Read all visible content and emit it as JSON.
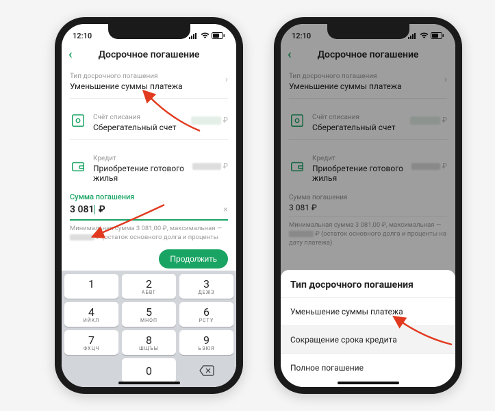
{
  "status": {
    "time": "12:10"
  },
  "nav": {
    "title": "Досрочное погашение"
  },
  "typeRow": {
    "label": "Тип досрочного погашения",
    "value": "Уменьшение суммы платежа"
  },
  "account": {
    "label": "Счёт списания",
    "value": "Сберегательный счет",
    "currency": "₽"
  },
  "credit": {
    "label": "Кредит",
    "value": "Приобретение готового жилья",
    "currency": "₽"
  },
  "amount": {
    "label": "Сумма погашения",
    "value": "3 081",
    "currency": "₽",
    "valueCombined": "3 081 ₽"
  },
  "hintLeft": "Минимальная сумма 3 081,00 ₽, максимальная —",
  "hintLeft2": "₽ (остаток основного долга и проценты",
  "hintRight1": "Минимальная сумма 3 081,00 ₽, максимальная —",
  "hintRight2": "₽ (остаток основного долга и проценты на дату платежа)",
  "continue": "Продолжить",
  "keypad": {
    "k1": "1",
    "k2": "2",
    "k2s": "АБВГ",
    "k3": "3",
    "k3s": "ДЕЖЗ",
    "k4": "4",
    "k4s": "ИЙКЛ",
    "k5": "5",
    "k5s": "МНОП",
    "k6": "6",
    "k6s": "РСТУ",
    "k7": "7",
    "k7s": "ФХЦЧ",
    "k8": "8",
    "k8s": "ШЩЪЫ",
    "k9": "9",
    "k9s": "ЬЭЮЯ",
    "k0": "0"
  },
  "sheet": {
    "title": "Тип досрочного погашения",
    "opt1": "Уменьшение суммы платежа",
    "opt2": "Сокращение срока кредита",
    "opt3": "Полное погашение"
  }
}
